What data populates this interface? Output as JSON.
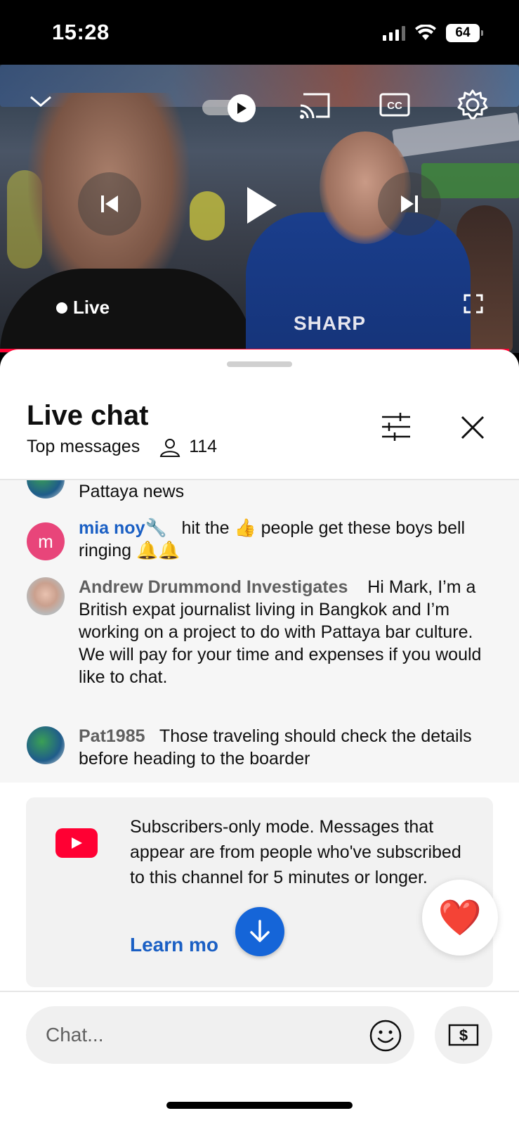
{
  "status_bar": {
    "time": "15:28",
    "battery": "64"
  },
  "player": {
    "live_label": "Live",
    "jersey_text": "SHARP",
    "icons": [
      "chevron-down-icon",
      "autoplay-toggle",
      "cast-icon",
      "cc-icon",
      "gear-icon",
      "previous-icon",
      "play-icon",
      "next-icon",
      "fullscreen-icon"
    ],
    "progress_color": "#ff0033"
  },
  "chat": {
    "title": "Live chat",
    "mode": "Top messages",
    "viewer_count": "114",
    "messages": [
      {
        "author": "",
        "text": "Pattaya news"
      },
      {
        "author": "mia noy",
        "author_badge": "🔧",
        "text": "hit the 👍 people get these boys bell ringing 🔔🔔",
        "avatar_letter": "m"
      },
      {
        "author": "Andrew Drummond Investigates",
        "text": "Hi Mark, I’m a British expat journalist living in Bangkok and I’m working on a project to do with Pattaya bar culture. We will pay for your time and expenses if you would like to chat."
      },
      {
        "author": "Pat1985",
        "text": "Those traveling should check the details before heading to the boarder"
      }
    ],
    "subscribers_notice": "Subscribers-only mode. Messages that appear are from people who've subscribed to this channel for 5 minutes or longer.",
    "learn_more": "Learn mo",
    "input_placeholder": "Chat...",
    "heart_emoji": "❤️",
    "colors": {
      "link": "#1a5fc4",
      "youtube_red": "#ff0033",
      "scroll_button": "#1565d8",
      "avatar_pink": "#e8457a"
    }
  }
}
